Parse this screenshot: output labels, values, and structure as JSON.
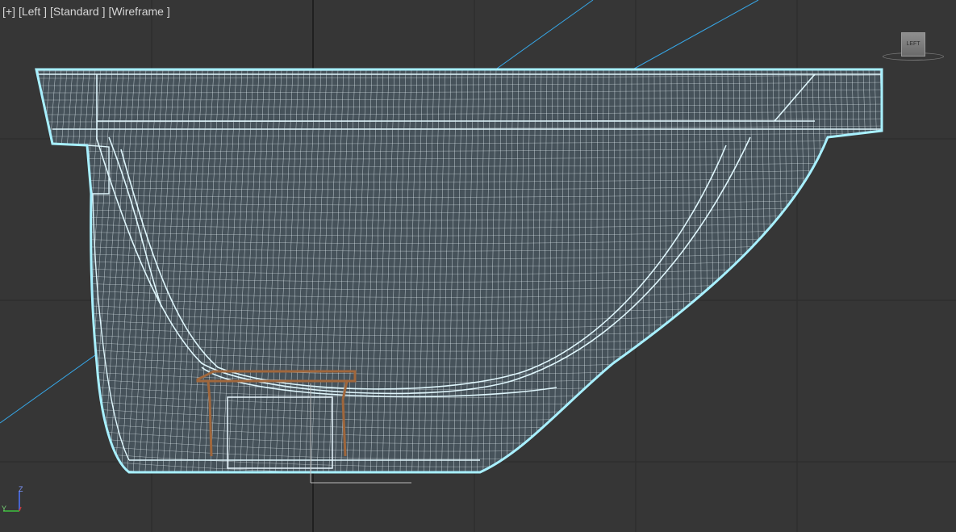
{
  "viewport": {
    "label_parts": [
      "[+]",
      "[Left ]",
      "[Standard ]",
      "[Wireframe ]"
    ]
  },
  "viewcube": {
    "face_label": "LEFT"
  },
  "axis": {
    "up": "Z",
    "right": "Y"
  },
  "colors": {
    "background": "#363636",
    "grid": "#2b2b2b",
    "grid_main": "#111111",
    "wire": "#ffffff",
    "selection": "#a8f0ff",
    "construction_line": "#36a6e6",
    "object": "#a0673c"
  }
}
